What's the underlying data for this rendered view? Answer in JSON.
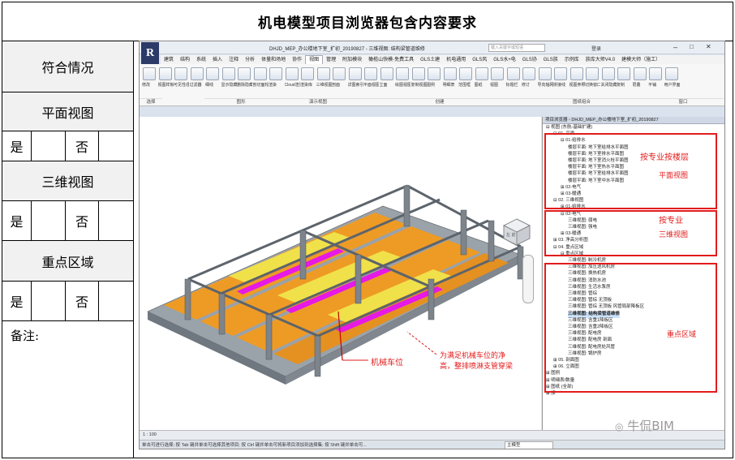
{
  "title": "机电模型项目浏览器包含内容要求",
  "left_panel": {
    "compliance_label": "符合情况",
    "floor_plan_label": "平面视图",
    "view3d_label": "三维视图",
    "key_area_label": "重点区域",
    "yes": "是",
    "no": "否",
    "notes_label": "备注:"
  },
  "app": {
    "window_title": "DHJD_MEP_办公楼地下室_扩初_20190827 - 三维视图: 结构梁管道维修",
    "search_placeholder": "键入关键字或短语",
    "login": "登录",
    "tabs": [
      "建筑",
      "结构",
      "系统",
      "插入",
      "注释",
      "分析",
      "体量和场地",
      "协作",
      "视图",
      "管理",
      "附加模块",
      "橄榄山快模-免费工具",
      "GLS土建",
      "机电通用",
      "GLS风",
      "GLS水+电",
      "GLS协",
      "GLS族",
      "示例库",
      "族库大师V4.0",
      "建模大师（施工）"
    ],
    "active_tab": "视图",
    "ribbon_buttons": [
      "修改",
      "视图样板",
      "可见性/图形",
      "过滤器",
      "细线",
      "显示隐藏线",
      "删除隐藏线",
      "剖切面轮廓",
      "渲染",
      "Cloud渲染",
      "渲染库",
      "三维视图",
      "剖面",
      "详图索引",
      "平面视图",
      "立面",
      "绘图视图",
      "复制视图",
      "图例",
      "明细表",
      "范围框",
      "图纸",
      "视图",
      "标题栏",
      "修订",
      "导向轴网",
      "拼接线",
      "视图参照",
      "切换窗口",
      "关闭隐藏对象",
      "复制",
      "层叠",
      "平铺",
      "用户界面"
    ],
    "ribbon_groups": [
      "选择",
      "图形",
      "演示视图",
      "创建",
      "图纸组合",
      "窗口"
    ],
    "browser_title": "项目浏览器 - DHJD_MEP_办公楼地下室_扩初_20190827",
    "tree": [
      {
        "level": 0,
        "text": "视图 (东航-基础扩建)"
      },
      {
        "level": 1,
        "text": "01. 平面"
      },
      {
        "level": 2,
        "text": "01-给排水"
      },
      {
        "level": 3,
        "text": "楼层平面: 地下室给排水平面图"
      },
      {
        "level": 3,
        "text": "楼层平面: 地下室排水平面图"
      },
      {
        "level": 3,
        "text": "楼层平面: 地下室消火栓平面图"
      },
      {
        "level": 3,
        "text": "楼层平面: 地下室热水平面图"
      },
      {
        "level": 3,
        "text": "楼层平面: 地下室给排水平面图"
      },
      {
        "level": 3,
        "text": "楼层平面: 地下室中水平面图"
      },
      {
        "level": 2,
        "text": "02-电气"
      },
      {
        "level": 2,
        "text": "03-暖通"
      },
      {
        "level": 1,
        "text": "02. 三维视图"
      },
      {
        "level": 2,
        "text": "01-给排水"
      },
      {
        "level": 2,
        "text": "02-电气"
      },
      {
        "level": 3,
        "text": "三维视图: 弱电"
      },
      {
        "level": 3,
        "text": "三维视图: 强电"
      },
      {
        "level": 2,
        "text": "03-暖通"
      },
      {
        "level": 1,
        "text": "03. 净高分析图"
      },
      {
        "level": 1,
        "text": "04. 重点区域"
      },
      {
        "level": 2,
        "text": "重点区域"
      },
      {
        "level": 3,
        "text": "三维视图: 制冷机房"
      },
      {
        "level": 3,
        "text": "三维视图: 加压送风机房"
      },
      {
        "level": 3,
        "text": "三维视图: 换热机房"
      },
      {
        "level": 3,
        "text": "三维视图: 消防水池"
      },
      {
        "level": 3,
        "text": "三维视图: 生活水泵房"
      },
      {
        "level": 3,
        "text": "三维视图: 管综"
      },
      {
        "level": 3,
        "text": "三维视图: 管综 无顶板"
      },
      {
        "level": 3,
        "text": "三维视图: 管综 无顶板 风管局部降板区"
      },
      {
        "level": 3,
        "text": "三维视图: 结构梁管道维修"
      },
      {
        "level": 3,
        "text": "三维视图: 含重1降板区"
      },
      {
        "level": 3,
        "text": "三维视图: 含重2降板区"
      },
      {
        "level": 3,
        "text": "三维视图: 配电房"
      },
      {
        "level": 3,
        "text": "三维视图: 配电房 剖面"
      },
      {
        "level": 3,
        "text": "三维视图: 配电房处风管"
      },
      {
        "level": 3,
        "text": "三维视图: 锅炉房"
      },
      {
        "level": 1,
        "text": "05. 剖面图"
      },
      {
        "level": 1,
        "text": "06. 立面图"
      },
      {
        "level": 0,
        "text": "图例"
      },
      {
        "level": 0,
        "text": "明细表/数量"
      },
      {
        "level": 0,
        "text": "图纸 (全部)"
      },
      {
        "level": 0,
        "text": "族"
      }
    ],
    "selected_item": "三维视图: 结构梁管道维修",
    "scale": "1 : 100",
    "status_text": "单击可进行选择; 按 Tab 键并单击可选择其他项目; 按 Ctrl 键并单击可将新项目添加到选择集; 按 Shift 键并单击可...",
    "model_label": "主模型",
    "viewcube_label": "左 前"
  },
  "annotations": {
    "by_discipline_floor": "按专业按楼层",
    "floor_plan": "平面视图",
    "by_discipline": "按专业",
    "view3d": "三维视图",
    "key_area": "重点区域",
    "parking_label": "机械车位",
    "parking_note_line1": "为满足机械车位的净",
    "parking_note_line2": "高，整排喷淋支管穿梁"
  },
  "watermark": "牛侃BIM",
  "colors": {
    "annotation": "#e21c1c",
    "slab_orange": "#f29b1d",
    "duct_yellow": "#f0e14a",
    "pipe_magenta": "#e619e6",
    "column_gray": "#7d848c"
  }
}
